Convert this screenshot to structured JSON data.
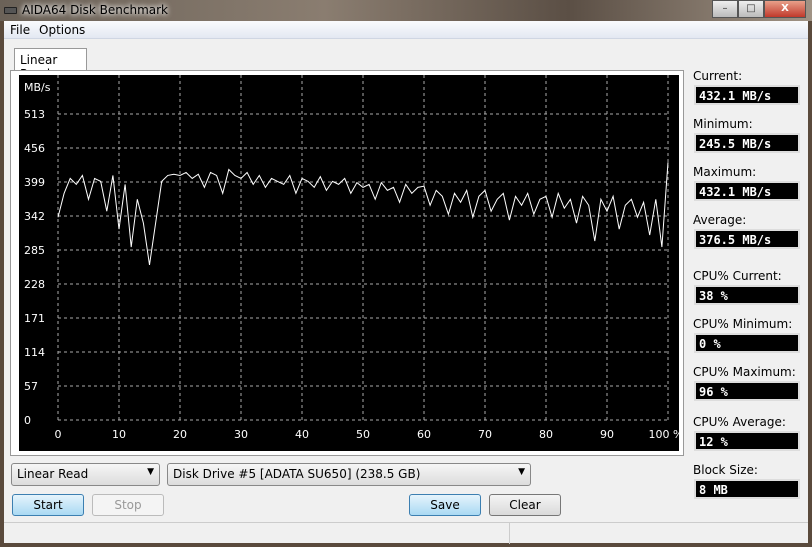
{
  "window": {
    "title": "AIDA64 Disk Benchmark",
    "min": "–",
    "max": "□",
    "close": "X"
  },
  "menu": [
    "File",
    "Options"
  ],
  "tab": "Linear Read",
  "stats": [
    {
      "label": "Current:",
      "value": "432.1 MB/s"
    },
    {
      "label": "Minimum:",
      "value": "245.5 MB/s"
    },
    {
      "label": "Maximum:",
      "value": "432.1 MB/s"
    },
    {
      "label": "Average:",
      "value": "376.5 MB/s"
    },
    {
      "label": "CPU% Current:",
      "value": "38 %"
    },
    {
      "label": "CPU% Minimum:",
      "value": "0 %"
    },
    {
      "label": "CPU% Maximum:",
      "value": "96 %"
    },
    {
      "label": "CPU% Average:",
      "value": "12 %"
    },
    {
      "label": "Block Size:",
      "value": "8 MB"
    }
  ],
  "controls": {
    "test": "Linear Read",
    "drive": "Disk Drive #5  [ADATA SU650]  (238.5 GB)",
    "start": "Start",
    "stop": "Stop",
    "save": "Save",
    "clear": "Clear"
  },
  "chart_data": {
    "type": "line",
    "ylabel": "MB/s",
    "ylim": [
      0,
      513
    ],
    "xlim": [
      0,
      100
    ],
    "yticks": [
      "0",
      "57",
      "114",
      "171",
      "228",
      "285",
      "342",
      "399",
      "456",
      "513"
    ],
    "xticks": [
      "0",
      "10",
      "20",
      "30",
      "40",
      "50",
      "60",
      "70",
      "80",
      "90",
      "100 %"
    ],
    "series": [
      {
        "name": "Linear Read",
        "color": "#ffffff",
        "x_step_percent": 1,
        "values": [
          340,
          380,
          405,
          395,
          410,
          370,
          405,
          400,
          350,
          410,
          320,
          395,
          290,
          370,
          330,
          260,
          330,
          400,
          410,
          412,
          410,
          415,
          405,
          412,
          390,
          415,
          410,
          380,
          420,
          410,
          405,
          415,
          395,
          410,
          390,
          405,
          400,
          395,
          410,
          380,
          405,
          400,
          390,
          408,
          385,
          400,
          395,
          405,
          380,
          398,
          390,
          395,
          370,
          398,
          385,
          390,
          365,
          395,
          380,
          390,
          392,
          360,
          385,
          375,
          345,
          380,
          365,
          385,
          340,
          375,
          385,
          350,
          370,
          380,
          335,
          375,
          360,
          380,
          345,
          370,
          375,
          340,
          380,
          355,
          370,
          330,
          375,
          360,
          300,
          370,
          350,
          375,
          320,
          360,
          370,
          340,
          365,
          310,
          370,
          290,
          432
        ]
      }
    ]
  }
}
